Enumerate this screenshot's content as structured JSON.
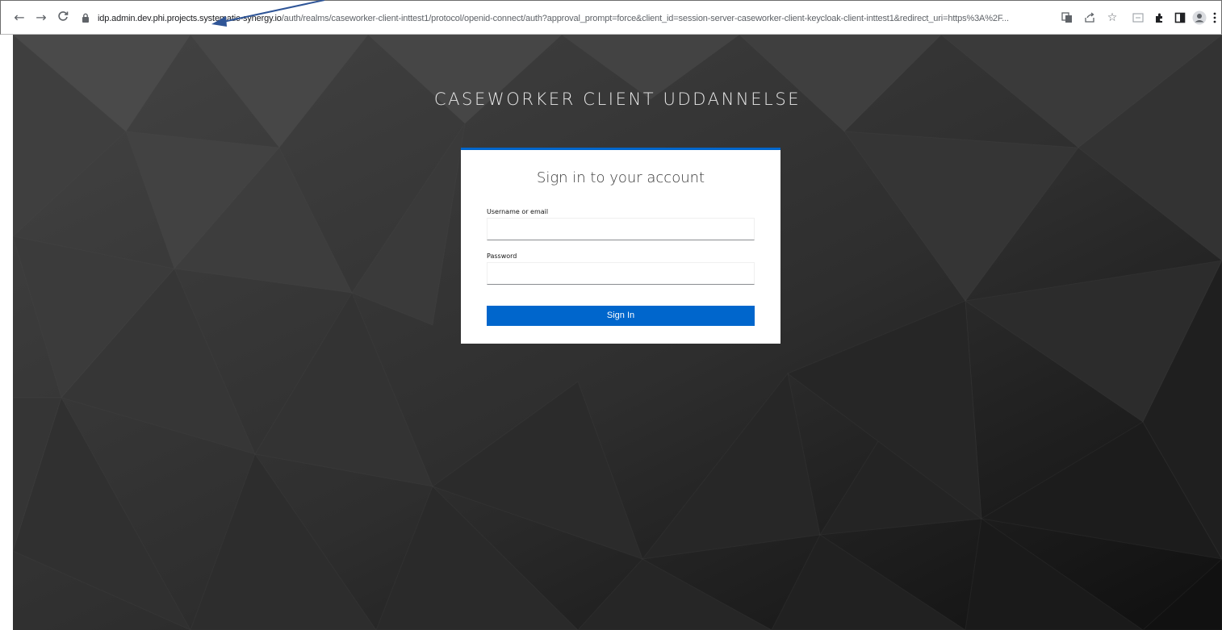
{
  "browser": {
    "url_host": "idp.admin.dev.phi.projects.systematic-synergy.io",
    "url_path": "/auth/realms/caseworker-client-inttest1/protocol/openid-connect/auth?approval_prompt=force&client_id=session-server-caseworker-client-keycloak-client-inttest1&redirect_uri=https%3A%2F...",
    "icons": [
      "back-arrow-icon",
      "forward-arrow-icon",
      "reload-icon",
      "lock-icon",
      "translate-icon",
      "share-icon",
      "star-icon",
      "tab-search-icon",
      "extensions-icon",
      "side-panel-icon",
      "profile-icon",
      "menu-icon"
    ]
  },
  "page": {
    "realm_title": "CASEWORKER CLIENT UDDANNELSE",
    "card_title": "Sign in to your account",
    "username_label": "Username or email",
    "username_value": "",
    "password_label": "Password",
    "password_value": "",
    "signin_label": "Sign In"
  },
  "colors": {
    "accent": "#0066cc",
    "background": "#2e2e2e",
    "annotation_arrow": "#2f5597"
  }
}
